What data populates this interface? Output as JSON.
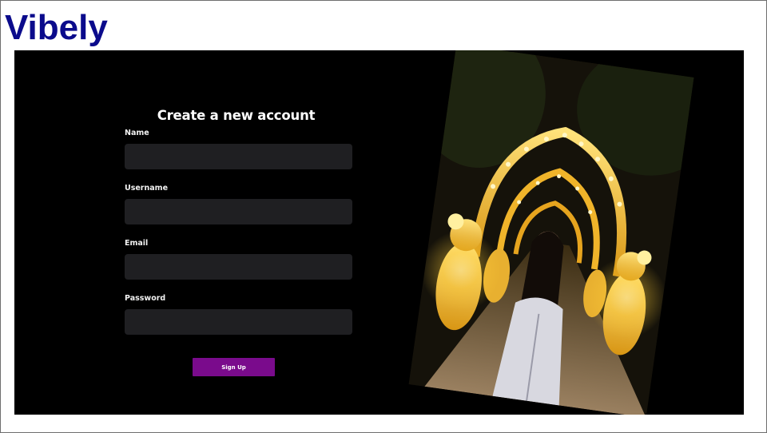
{
  "brand": {
    "name": "Vibely",
    "color": "#0b0b8c"
  },
  "signup_form": {
    "title": "Create a new account",
    "fields": [
      {
        "label": "Name",
        "value": "",
        "type": "text"
      },
      {
        "label": "Username",
        "value": "",
        "type": "text"
      },
      {
        "label": "Email",
        "value": "",
        "type": "email"
      },
      {
        "label": "Password",
        "value": "",
        "type": "password"
      }
    ],
    "submit_label": "Sign Up",
    "submit_color": "#7a0b8c",
    "input_background": "#1f1f22"
  },
  "hero_image": {
    "subject": "illuminated-lantern-archway-photo"
  }
}
